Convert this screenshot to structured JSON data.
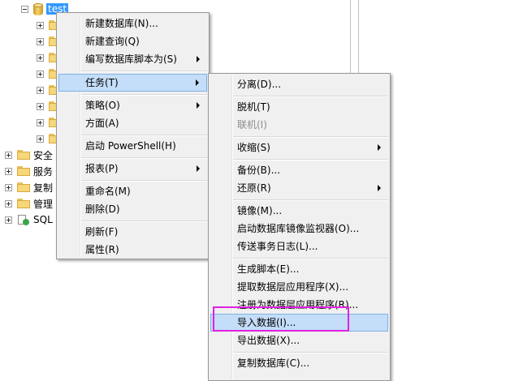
{
  "tree": {
    "database_name": "test",
    "nodes": [
      {
        "label": "安全"
      },
      {
        "label": "服务"
      },
      {
        "label": "复制"
      },
      {
        "label": "管理"
      },
      {
        "label": "SQL"
      }
    ]
  },
  "context_menu": {
    "items": [
      {
        "label": "新建数据库(N)..."
      },
      {
        "label": "新建查询(Q)"
      },
      {
        "label": "编写数据库脚本为(S)"
      },
      {
        "label": "任务(T)"
      },
      {
        "label": "策略(O)"
      },
      {
        "label": "方面(A)"
      },
      {
        "label": "启动 PowerShell(H)"
      },
      {
        "label": "报表(P)"
      },
      {
        "label": "重命名(M)"
      },
      {
        "label": "删除(D)"
      },
      {
        "label": "刷新(F)"
      },
      {
        "label": "属性(R)"
      }
    ]
  },
  "tasks_submenu": {
    "items": [
      {
        "label": "分离(D)..."
      },
      {
        "label": "脱机(T)"
      },
      {
        "label": "联机(I)"
      },
      {
        "label": "收缩(S)"
      },
      {
        "label": "备份(B)..."
      },
      {
        "label": "还原(R)"
      },
      {
        "label": "镜像(M)..."
      },
      {
        "label": "启动数据库镜像监视器(O)..."
      },
      {
        "label": "传送事务日志(L)..."
      },
      {
        "label": "生成脚本(E)..."
      },
      {
        "label": "提取数据层应用程序(X)..."
      },
      {
        "label": "注册为数据层应用程序(R)..."
      },
      {
        "label": "导入数据(I)..."
      },
      {
        "label": "导出数据(X)..."
      },
      {
        "label": "复制数据库(C)..."
      }
    ]
  },
  "colors": {
    "highlight": "#c4ddf8",
    "selection": "#3399ff",
    "annotation_box": "#e020e0"
  }
}
